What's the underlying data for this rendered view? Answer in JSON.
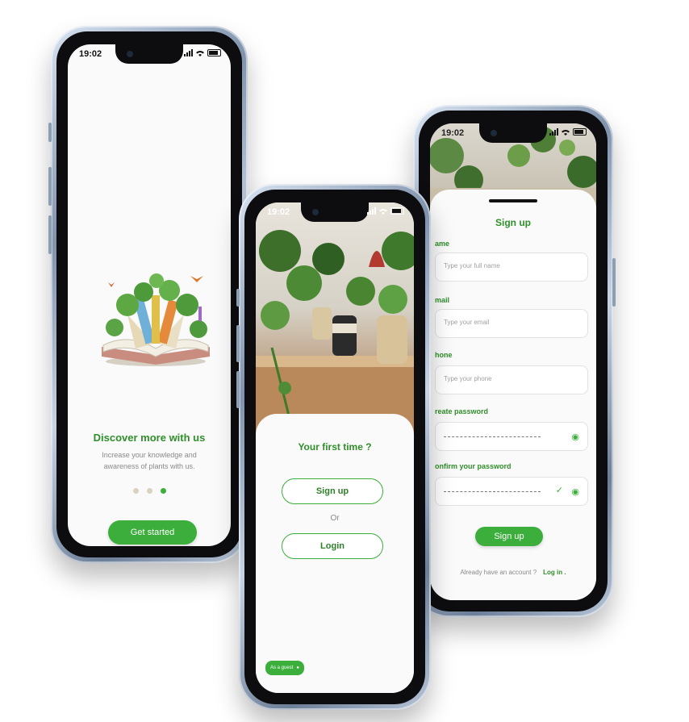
{
  "status": {
    "time": "19:02"
  },
  "onboarding": {
    "title": "Discover more with us",
    "subtitle_line1": "Increase your knowledge and",
    "subtitle_line2": "awareness of plants with us.",
    "cta": "Get started",
    "page_count": 3,
    "active_page": 3
  },
  "welcome": {
    "title": "Your first time ?",
    "signup": "Sign up",
    "or": "Or",
    "login": "Login",
    "guest": "As a guest"
  },
  "signup": {
    "title": "Sign up",
    "fields": [
      {
        "label": "Name",
        "visible_label": "ame",
        "placeholder": "Type your full name"
      },
      {
        "label": "Email",
        "visible_label": "mail",
        "placeholder": "Type your email"
      },
      {
        "label": "Phone",
        "visible_label": "hone",
        "placeholder": "Type your phone"
      },
      {
        "label": "Create password",
        "visible_label": "reate password",
        "placeholder": ""
      },
      {
        "label": "Confirm your password",
        "visible_label": "onfirm your password",
        "placeholder": ""
      }
    ],
    "submit": "Sign up",
    "already": "Already have an account ?",
    "login_link": "Log in ."
  },
  "colors": {
    "accent": "#3bae3b",
    "accent_dark": "#2f8f2a"
  }
}
